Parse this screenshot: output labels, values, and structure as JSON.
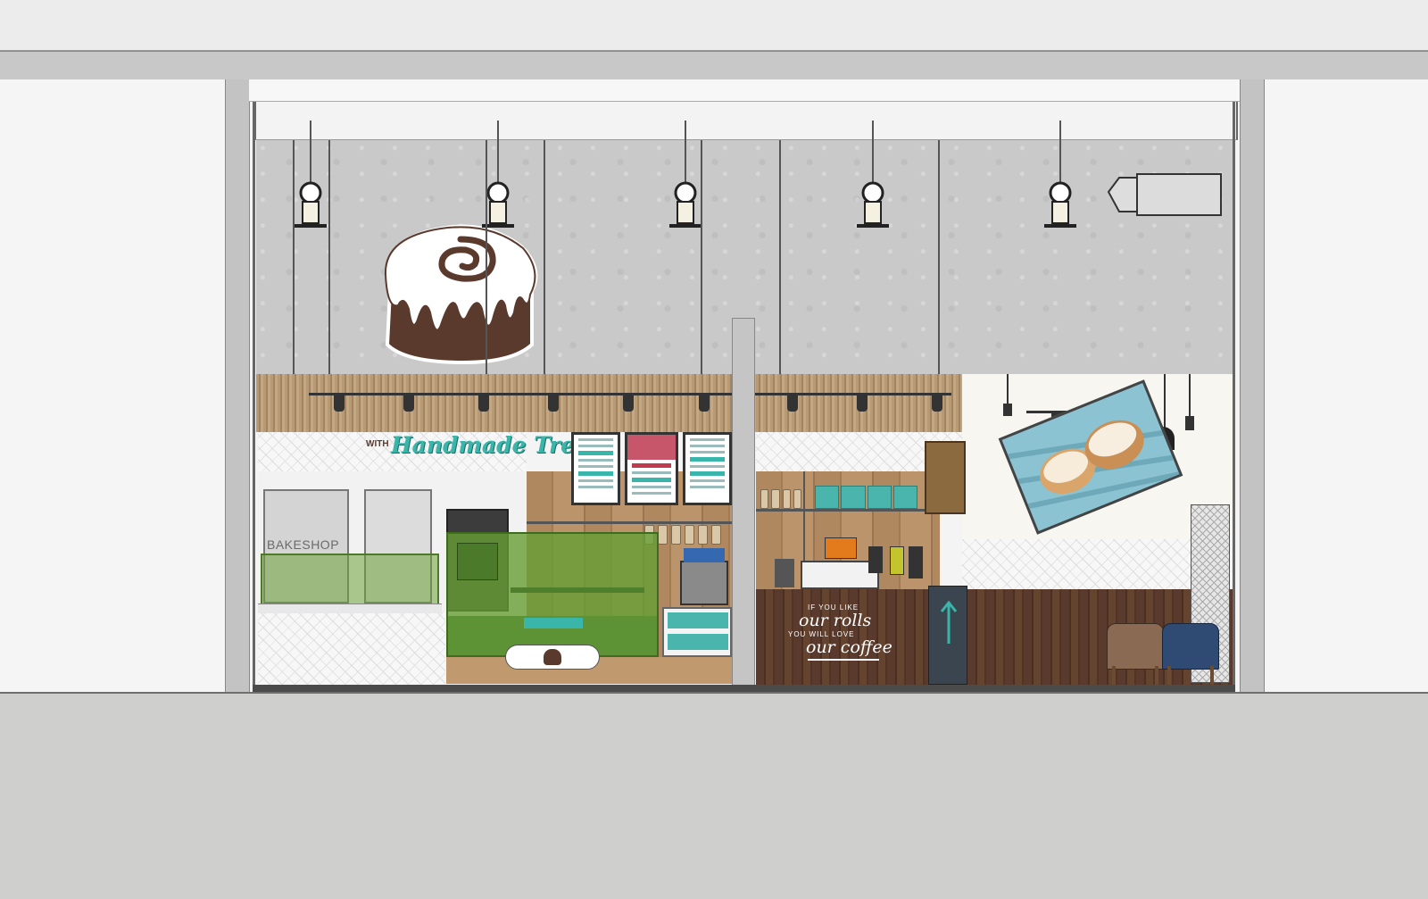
{
  "sign_script": {
    "prefix": "WITH",
    "main": "Handmade Treats"
  },
  "bakeshop_label": "BAKESHOP",
  "counter_slogan": {
    "line1": "IF YOU LIKE",
    "line2": "our rolls",
    "line3": "YOU WILL LOVE",
    "line4": "our coffee"
  },
  "icons": {
    "logo": "cinnamon-roll-icon",
    "pendant": "pendant-lamp-icon",
    "track": "track-spotlight-icon",
    "arrow": "arrow-up-icon"
  },
  "colors": {
    "brand_brown": "#5b3a2e",
    "teal_accent": "#3ab5a9",
    "glass_green": "#6ea33a",
    "concrete": "#c9c9c9",
    "dark_wood": "#5a3a2c",
    "chair_brown": "#8a6a52",
    "chair_navy": "#2f4a73"
  }
}
